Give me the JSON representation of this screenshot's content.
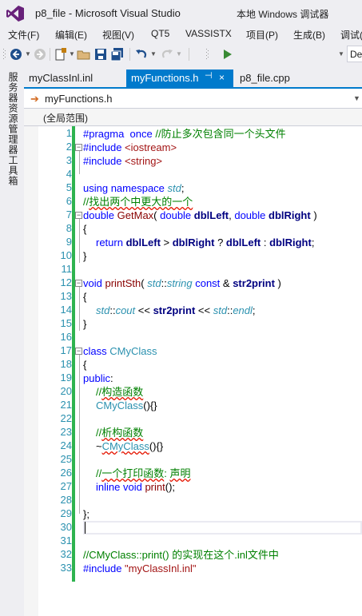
{
  "window": {
    "title": "p8_file - Microsoft Visual Studio"
  },
  "menu": [
    "文件(F)",
    "编辑(E)",
    "视图(V)",
    "QT5",
    "VASSISTX",
    "项目(P)",
    "生成(B)",
    "调试("
  ],
  "toolbar": {
    "run_label": "本地 Windows 调试器",
    "config_value": "De"
  },
  "sidebar": {
    "server_explorer": "服务器资源管理器",
    "toolbox": "工具箱"
  },
  "tabs": [
    {
      "label": "myClassInl.inl",
      "active": false
    },
    {
      "label": "myFunctions.h",
      "active": true,
      "pin": "⊣",
      "close": "×"
    },
    {
      "label": "p8_file.cpp",
      "active": false
    }
  ],
  "navigation": {
    "file": "myFunctions.h",
    "scope": "(全局范围)"
  },
  "editor": {
    "line_numbers": [
      "1",
      "2",
      "3",
      "4",
      "5",
      "6",
      "7",
      "8",
      "9",
      "10",
      "11",
      "12",
      "13",
      "14",
      "15",
      "16",
      "17",
      "18",
      "19",
      "20",
      "21",
      "22",
      "23",
      "24",
      "25",
      "26",
      "27",
      "28",
      "29",
      "30",
      "31",
      "32",
      "33"
    ],
    "lines": {
      "l1_a": "#pragma  once ",
      "l1_b": "//防止多次包含同一个头文件",
      "l2_a": "#include ",
      "l2_b": "<iostream>",
      "l3_a": "#include ",
      "l3_b": "<string>",
      "l5_a": "using namespace ",
      "l5_b": "std",
      "l5_c": ";",
      "l6_a": "//",
      "l6_b": "找出两个中更大的一个",
      "l7_a": "double ",
      "l7_b": "GetMax",
      "l7_c": "( ",
      "l7_d": "double ",
      "l7_e": "dblLeft",
      "l7_f": ", ",
      "l7_g": "double ",
      "l7_h": "dblRight",
      "l7_i": " )",
      "l8": "{",
      "l9_a": "return ",
      "l9_b": "dblLeft",
      "l9_c": " > ",
      "l9_d": "dblRight",
      "l9_e": " ? ",
      "l9_f": "dblLeft",
      "l9_g": " : ",
      "l9_h": "dblRight",
      "l9_i": ";",
      "l10": "}",
      "l12_a": "void ",
      "l12_b": "printSth",
      "l12_c": "( ",
      "l12_d": "std",
      "l12_e": "::",
      "l12_f": "string",
      "l12_g": " const ",
      "l12_h": "& ",
      "l12_i": "str2print",
      "l12_j": " )",
      "l13": "{",
      "l14_a": "std",
      "l14_b": "::",
      "l14_c": "cout",
      "l14_d": " << ",
      "l14_e": "str2print",
      "l14_f": " << ",
      "l14_g": "std",
      "l14_h": "::",
      "l14_i": "endl",
      "l14_j": ";",
      "l15": "}",
      "l17_a": "class ",
      "l17_b": "CMyClass",
      "l18": "{",
      "l19_a": "public",
      "l19_b": ":",
      "l20_a": "//",
      "l20_b": "构造函数",
      "l21_a": "CMyClass",
      "l21_b": "(){}",
      "l23_a": "//",
      "l23_b": "析构函数",
      "l24_a": "~",
      "l24_b": "CMyClass",
      "l24_c": "(){}",
      "l26_a": "//",
      "l26_b": "一个打印函数",
      "l26_c": ": ",
      "l26_d": "声明",
      "l27_a": "inline ",
      "l27_b": "void ",
      "l27_c": "print",
      "l27_d": "();",
      "l29": "};",
      "l32": "//CMyClass::print() 的实现在这个.inl文件中",
      "l33_a": "#include ",
      "l33_b": "\"myClassInl.inl\""
    }
  },
  "colors": {
    "accent": "#007acc",
    "change_bar": "#2eb34f",
    "keyword": "#0000ff",
    "comment": "#008000",
    "string": "#a31515",
    "type": "#2b91af"
  }
}
